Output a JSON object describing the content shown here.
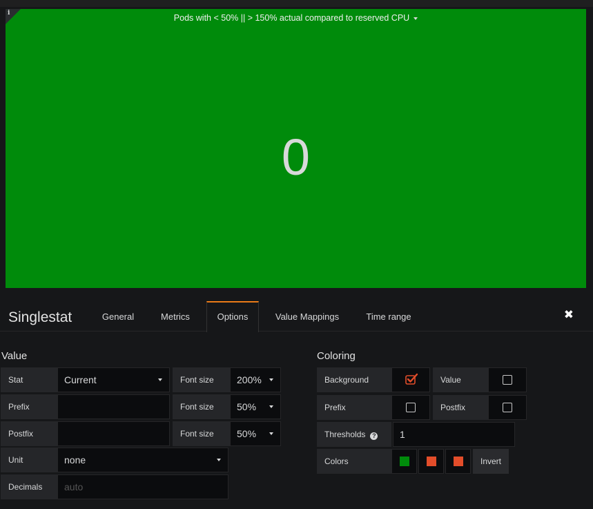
{
  "panel": {
    "info_icon": "i",
    "title": "Pods with < 50% || > 150% actual compared to reserved CPU",
    "value": "0",
    "background_color": "#008b0b"
  },
  "editor": {
    "title": "Singlestat",
    "tabs": [
      {
        "label": "General"
      },
      {
        "label": "Metrics"
      },
      {
        "label": "Options",
        "active": true
      },
      {
        "label": "Value Mappings"
      },
      {
        "label": "Time range"
      }
    ],
    "close_icon": "✖"
  },
  "value_section": {
    "title": "Value",
    "stat_label": "Stat",
    "stat_value": "Current",
    "prefix_label": "Prefix",
    "prefix_value": "",
    "postfix_label": "Postfix",
    "postfix_value": "",
    "unit_label": "Unit",
    "unit_value": "none",
    "decimals_label": "Decimals",
    "decimals_placeholder": "auto",
    "font_size_label": "Font size",
    "value_font_size": "200%",
    "prefix_font_size": "50%",
    "postfix_font_size": "50%"
  },
  "coloring": {
    "title": "Coloring",
    "background_label": "Background",
    "background_checked": true,
    "value_label": "Value",
    "value_checked": false,
    "prefix_label": "Prefix",
    "prefix_checked": false,
    "postfix_label": "Postfix",
    "postfix_checked": false,
    "thresholds_label": "Thresholds",
    "thresholds_value": "1",
    "colors_label": "Colors",
    "colors": [
      "#008b0b",
      "#e24d2a",
      "#e24d2a"
    ],
    "invert_label": "Invert",
    "accent": "#eb7b18"
  }
}
